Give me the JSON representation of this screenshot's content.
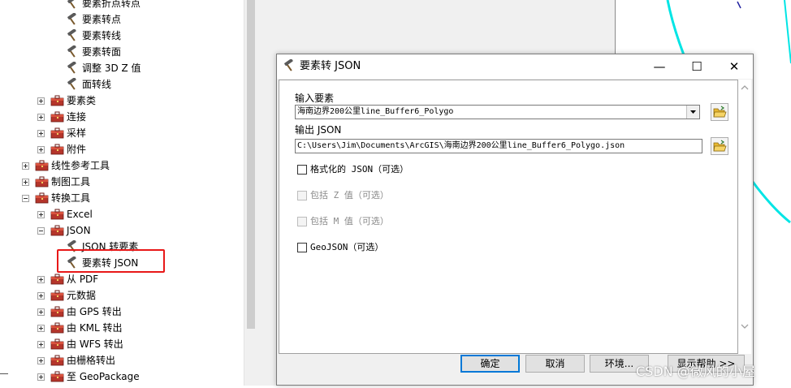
{
  "toolbox": {
    "items": [
      {
        "label": "要素折点转点",
        "kind": "tool"
      },
      {
        "label": "要素转点",
        "kind": "tool"
      },
      {
        "label": "要素转线",
        "kind": "tool"
      },
      {
        "label": "要素转面",
        "kind": "tool"
      },
      {
        "label": "调整 3D Z 值",
        "kind": "tool"
      },
      {
        "label": "面转线",
        "kind": "tool"
      },
      {
        "label": "要素类",
        "kind": "toolset",
        "state": "collapsed"
      },
      {
        "label": "连接",
        "kind": "toolset",
        "state": "collapsed"
      },
      {
        "label": "采样",
        "kind": "toolset",
        "state": "collapsed"
      },
      {
        "label": "附件",
        "kind": "toolset",
        "state": "collapsed"
      },
      {
        "label": "线性参考工具",
        "kind": "toolbox",
        "state": "collapsed"
      },
      {
        "label": "制图工具",
        "kind": "toolbox",
        "state": "collapsed"
      },
      {
        "label": "转换工具",
        "kind": "toolbox",
        "state": "expanded"
      },
      {
        "label": "Excel",
        "kind": "toolset",
        "state": "collapsed"
      },
      {
        "label": "JSON",
        "kind": "toolset",
        "state": "expanded"
      },
      {
        "label": "JSON 转要素",
        "kind": "tool"
      },
      {
        "label": "要素转 JSON",
        "kind": "tool",
        "highlighted": true
      },
      {
        "label": "从 PDF",
        "kind": "toolset",
        "state": "collapsed"
      },
      {
        "label": "元数据",
        "kind": "toolset",
        "state": "collapsed"
      },
      {
        "label": "由 GPS 转出",
        "kind": "toolset",
        "state": "collapsed"
      },
      {
        "label": "由 KML 转出",
        "kind": "toolset",
        "state": "collapsed"
      },
      {
        "label": "由 WFS 转出",
        "kind": "toolset",
        "state": "collapsed"
      },
      {
        "label": "由栅格转出",
        "kind": "toolset",
        "state": "collapsed"
      },
      {
        "label": "至 GeoPackage",
        "kind": "toolset",
        "state": "collapsed"
      }
    ]
  },
  "dialog": {
    "title": "要素转 JSON",
    "title_icon": "hammer-icon",
    "window_buttons": {
      "minimize": "—",
      "maximize": "☐",
      "close": "✕"
    },
    "input_label": "输入要素",
    "input_value": "海南边界200公里line_Buffer6_Polygo",
    "output_label": "输出 JSON",
    "output_value": "C:\\Users\\Jim\\Documents\\ArcGIS\\海南边界200公里line_Buffer6_Polygo.json",
    "checkboxes": [
      {
        "label": "格式化的 JSON（可选）",
        "checked": false,
        "enabled": true
      },
      {
        "label": "包括 Z 值（可选）",
        "checked": false,
        "enabled": false
      },
      {
        "label": "包括 M 值（可选）",
        "checked": false,
        "enabled": false
      },
      {
        "label": "GeoJSON（可选）",
        "checked": false,
        "enabled": true
      }
    ],
    "buttons": {
      "ok": "确定",
      "cancel": "取消",
      "environments": "环境...",
      "show_help": "显示帮助 >>"
    }
  },
  "watermark": "CSDN @微风的小屋",
  "colors": {
    "highlight_box": "#e81818",
    "default_button_border": "#0078d7",
    "map_feature": "#00e5e5"
  }
}
